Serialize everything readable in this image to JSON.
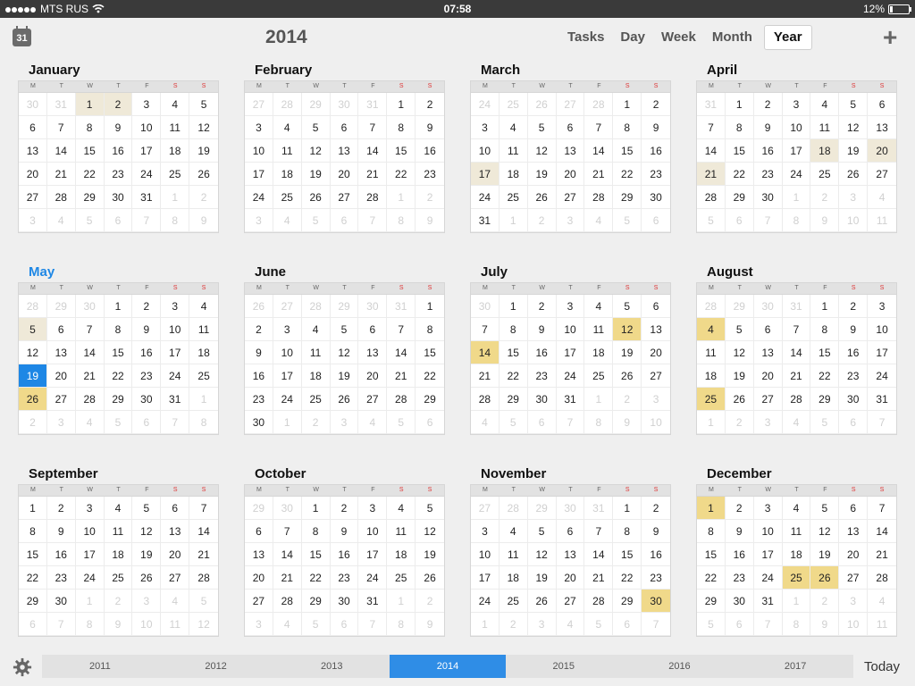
{
  "status": {
    "carrier": "MTS RUS",
    "time": "07:58",
    "battery": "12%"
  },
  "toolbar": {
    "calendar_icon_text": "31",
    "year_title": "2014",
    "segments": [
      "Tasks",
      "Day",
      "Week",
      "Month",
      "Year"
    ],
    "active_segment": "Year",
    "add_label": "+"
  },
  "weekdays": [
    "M",
    "T",
    "W",
    "T",
    "F",
    "S",
    "S"
  ],
  "months": [
    {
      "name": "January",
      "lead": [
        30,
        31
      ],
      "days": 31,
      "trail": [
        1,
        2,
        3,
        4,
        5,
        6,
        7,
        8,
        9
      ],
      "light": [
        1,
        2
      ],
      "gold": [],
      "today": null
    },
    {
      "name": "February",
      "lead": [
        27,
        28,
        29,
        30,
        31
      ],
      "days": 28,
      "trail": [
        1,
        2,
        3,
        4,
        5,
        6,
        7,
        8,
        9
      ],
      "light": [],
      "gold": [],
      "today": null
    },
    {
      "name": "March",
      "lead": [
        24,
        25,
        26,
        27,
        28
      ],
      "days": 31,
      "trail": [
        1,
        2,
        3,
        4,
        5,
        6
      ],
      "light": [
        17
      ],
      "gold": [],
      "today": null
    },
    {
      "name": "April",
      "lead": [
        31
      ],
      "days": 30,
      "trail": [
        1,
        2,
        3,
        4,
        5,
        6,
        7,
        8,
        9,
        10,
        11
      ],
      "light": [
        18,
        20,
        21
      ],
      "gold": [],
      "today": null
    },
    {
      "name": "May",
      "lead": [
        28,
        29,
        30
      ],
      "days": 31,
      "trail": [
        1,
        2,
        3,
        4,
        5,
        6,
        7,
        8
      ],
      "light": [
        5
      ],
      "gold": [
        26
      ],
      "today": 19,
      "current": true
    },
    {
      "name": "June",
      "lead": [
        26,
        27,
        28,
        29,
        30,
        31
      ],
      "days": 30,
      "trail": [
        1,
        2,
        3,
        4,
        5,
        6
      ],
      "light": [],
      "gold": [],
      "today": null
    },
    {
      "name": "July",
      "lead": [
        30
      ],
      "days": 31,
      "trail": [
        1,
        2,
        3,
        4,
        5,
        6,
        7,
        8,
        9,
        10
      ],
      "light": [],
      "gold": [
        12,
        14
      ],
      "today": null
    },
    {
      "name": "August",
      "lead": [
        28,
        29,
        30,
        31
      ],
      "days": 31,
      "trail": [
        1,
        2,
        3,
        4,
        5,
        6,
        7
      ],
      "light": [],
      "gold": [
        4,
        25
      ],
      "today": null
    },
    {
      "name": "September",
      "lead": [],
      "days": 30,
      "trail": [
        1,
        2,
        3,
        4,
        5,
        6,
        7,
        8,
        9,
        10,
        11,
        12
      ],
      "light": [],
      "gold": [],
      "today": null
    },
    {
      "name": "October",
      "lead": [
        29,
        30
      ],
      "days": 31,
      "trail": [
        1,
        2,
        3,
        4,
        5,
        6,
        7,
        8,
        9
      ],
      "light": [],
      "gold": [],
      "today": null
    },
    {
      "name": "November",
      "lead": [
        27,
        28,
        29,
        30,
        31
      ],
      "days": 30,
      "trail": [
        1,
        2,
        3,
        4,
        5,
        6,
        7
      ],
      "light": [],
      "gold": [
        30
      ],
      "today": null
    },
    {
      "name": "December",
      "lead": [],
      "days": 31,
      "trail": [
        1,
        2,
        3,
        4,
        5,
        6,
        7,
        8,
        9,
        10,
        11
      ],
      "light": [],
      "gold": [
        1,
        25,
        26
      ],
      "today": null
    }
  ],
  "years": [
    "2011",
    "2012",
    "2013",
    "2014",
    "2015",
    "2016",
    "2017"
  ],
  "active_year": "2014",
  "today_label": "Today"
}
